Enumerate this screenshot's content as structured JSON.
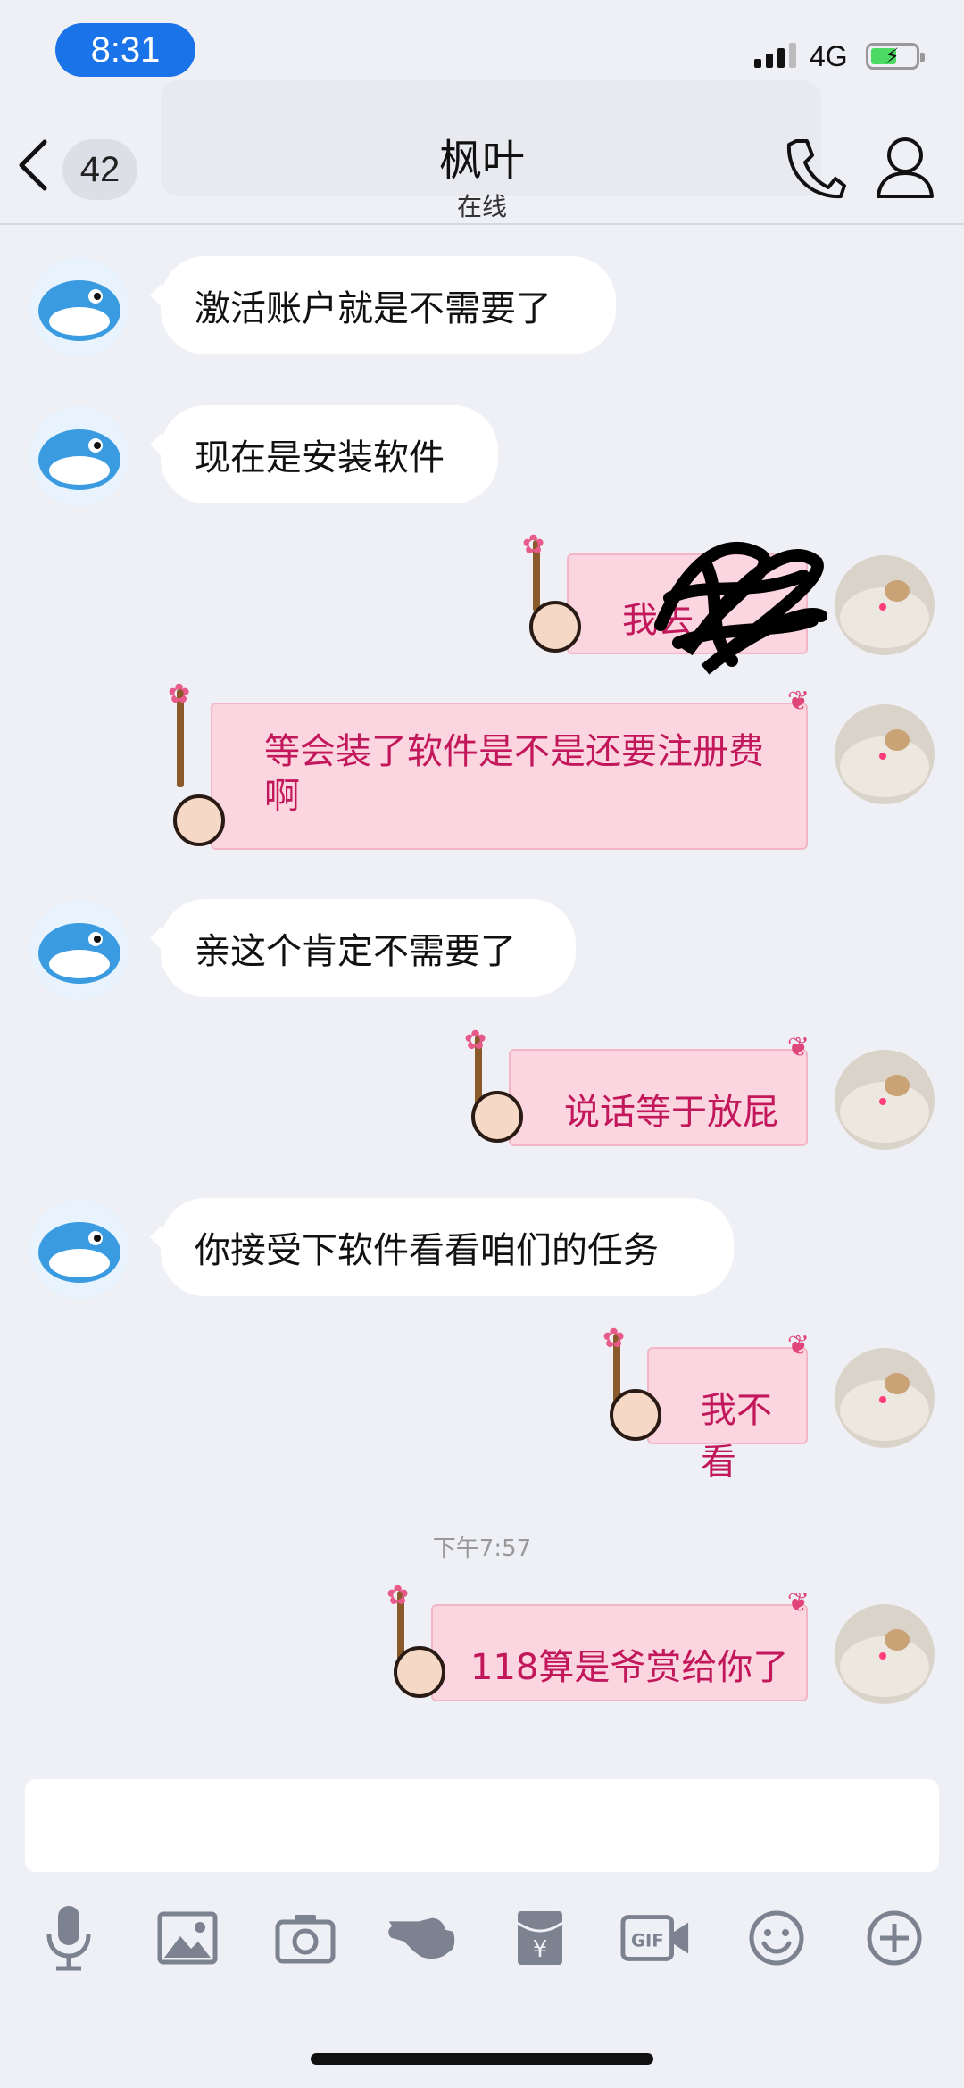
{
  "status_bar": {
    "time": "8:31",
    "network": "4G"
  },
  "header": {
    "unread_count": "42",
    "title": "枫叶",
    "subtitle": "在线"
  },
  "messages": [
    {
      "side": "in",
      "text": "激活账户就是不需要了"
    },
    {
      "side": "in",
      "text": "现在是安装软件"
    },
    {
      "side": "out",
      "text": "我去"
    },
    {
      "side": "out",
      "text": "等会装了软件是不是还要注册费啊"
    },
    {
      "side": "in",
      "text": "亲这个肯定不需要了"
    },
    {
      "side": "out",
      "text": "说话等于放屁"
    },
    {
      "side": "in",
      "text": "你接受下软件看看咱们的任务"
    },
    {
      "side": "out",
      "text": "我不看"
    },
    {
      "side": "out",
      "text": "118算是爷赏给你了"
    }
  ],
  "timestamp": "下午7:57",
  "toolbar": [
    "mic-icon",
    "image-icon",
    "camera-icon",
    "poke-icon",
    "red-packet-icon",
    "gif-icon",
    "emoji-icon",
    "plus-icon"
  ],
  "colors": {
    "accent": "#1a73e8",
    "outgoing_bubble": "#fbd5e0",
    "outgoing_text": "#c2185b"
  }
}
